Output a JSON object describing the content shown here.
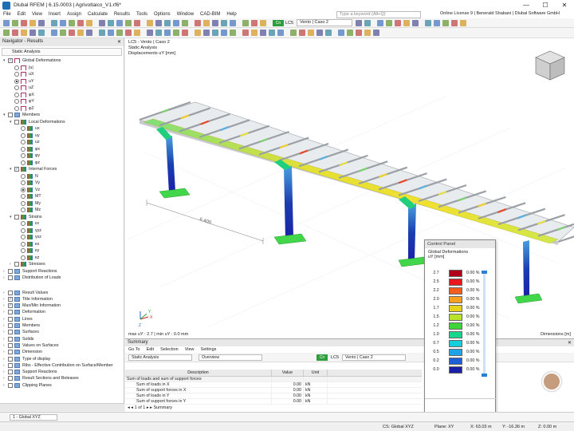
{
  "window": {
    "title": "Dlubal RFEM | 6.15.0003 | Agrivoltaico_V1.rf6*",
    "min": "—",
    "max": "☐",
    "close": "✕"
  },
  "menu": [
    "File",
    "Edit",
    "View",
    "Insert",
    "Assign",
    "Calculate",
    "Results",
    "Tools",
    "Options",
    "Window",
    "CAD-BIM",
    "Help"
  ],
  "search": {
    "placeholder": "Type a keyword (Alt+Q)"
  },
  "license": "Online License 9 | Benerald Shabani | Dlubal Software GmbH",
  "toolbar": {
    "load_tag": "Cn",
    "lc": "LC5",
    "lc_name": "Vento | Caso 2"
  },
  "navigator": {
    "title": "Navigator - Results",
    "combo": "Static Analysis",
    "items": [
      {
        "t": "Global Deformations",
        "lvl": 0,
        "ex": "▾",
        "c": "check",
        "on": true,
        "i": "ic"
      },
      {
        "t": "|u|",
        "lvl": 1,
        "c": "radio",
        "on": false,
        "i": "ic"
      },
      {
        "t": "uX",
        "lvl": 1,
        "c": "radio",
        "on": false,
        "i": "ic"
      },
      {
        "t": "uY",
        "lvl": 1,
        "c": "radio",
        "on": true,
        "i": "ic"
      },
      {
        "t": "uZ",
        "lvl": 1,
        "c": "radio",
        "on": false,
        "i": "ic"
      },
      {
        "t": "φX",
        "lvl": 1,
        "c": "radio",
        "on": false,
        "i": "ic"
      },
      {
        "t": "φY",
        "lvl": 1,
        "c": "radio",
        "on": false,
        "i": "ic"
      },
      {
        "t": "φZ",
        "lvl": 1,
        "c": "radio",
        "on": false,
        "i": "ic"
      },
      {
        "t": "Members",
        "lvl": 0,
        "ex": "▾",
        "c": "check",
        "on": false,
        "i": "ic3"
      },
      {
        "t": "Local Deformations",
        "lvl": 1,
        "ex": "▾",
        "c": "check",
        "on": false,
        "i": "ic2"
      },
      {
        "t": "ux",
        "lvl": 2,
        "c": "radio",
        "on": false,
        "i": "ic2"
      },
      {
        "t": "uy",
        "lvl": 2,
        "c": "radio",
        "on": false,
        "i": "ic2"
      },
      {
        "t": "uz",
        "lvl": 2,
        "c": "radio",
        "on": false,
        "i": "ic2"
      },
      {
        "t": "φx",
        "lvl": 2,
        "c": "radio",
        "on": false,
        "i": "ic2"
      },
      {
        "t": "φy",
        "lvl": 2,
        "c": "radio",
        "on": false,
        "i": "ic2"
      },
      {
        "t": "φz",
        "lvl": 2,
        "c": "radio",
        "on": false,
        "i": "ic2"
      },
      {
        "t": "Internal Forces",
        "lvl": 1,
        "ex": "▾",
        "c": "check",
        "on": true,
        "i": "ic2"
      },
      {
        "t": "N",
        "lvl": 2,
        "c": "radio",
        "on": false,
        "i": "ic2"
      },
      {
        "t": "Vy",
        "lvl": 2,
        "c": "radio",
        "on": false,
        "i": "ic2"
      },
      {
        "t": "Vz",
        "lvl": 2,
        "c": "radio",
        "on": true,
        "i": "ic2"
      },
      {
        "t": "MT",
        "lvl": 2,
        "c": "radio",
        "on": false,
        "i": "ic2"
      },
      {
        "t": "My",
        "lvl": 2,
        "c": "radio",
        "on": false,
        "i": "ic2"
      },
      {
        "t": "Mz",
        "lvl": 2,
        "c": "radio",
        "on": false,
        "i": "ic2"
      },
      {
        "t": "Strains",
        "lvl": 1,
        "ex": "▾",
        "c": "check",
        "on": false,
        "i": "ic2"
      },
      {
        "t": "εx",
        "lvl": 2,
        "c": "radio",
        "on": false,
        "i": "ic2"
      },
      {
        "t": "γyz",
        "lvl": 2,
        "c": "radio",
        "on": false,
        "i": "ic2"
      },
      {
        "t": "γxz",
        "lvl": 2,
        "c": "radio",
        "on": false,
        "i": "ic2"
      },
      {
        "t": "κx",
        "lvl": 2,
        "c": "radio",
        "on": false,
        "i": "ic2"
      },
      {
        "t": "κy",
        "lvl": 2,
        "c": "radio",
        "on": false,
        "i": "ic2"
      },
      {
        "t": "κz",
        "lvl": 2,
        "c": "radio",
        "on": false,
        "i": "ic2"
      },
      {
        "t": "Stresses",
        "lvl": 1,
        "ex": "›",
        "c": "check",
        "on": false,
        "i": "ic2"
      },
      {
        "t": "Support Reactions",
        "lvl": 0,
        "ex": "›",
        "c": "check",
        "on": false,
        "i": "ic3"
      },
      {
        "t": "Distribution of Loads",
        "lvl": 0,
        "ex": "›",
        "c": "check",
        "on": false,
        "i": "ic3"
      }
    ],
    "items2": [
      {
        "t": "Result Values",
        "ex": "›",
        "on": false
      },
      {
        "t": "Title Information",
        "ex": "›",
        "on": true
      },
      {
        "t": "Max/Min Information",
        "ex": "›",
        "on": true
      },
      {
        "t": "Deformation",
        "ex": "›",
        "on": false
      },
      {
        "t": "Lines",
        "ex": "›",
        "on": false
      },
      {
        "t": "Members",
        "ex": "›",
        "on": false
      },
      {
        "t": "Surfaces",
        "ex": "›",
        "on": false
      },
      {
        "t": "Solids",
        "ex": "›",
        "on": false
      },
      {
        "t": "Values on Surfaces",
        "ex": "›",
        "on": false
      },
      {
        "t": "Dimension",
        "ex": "›",
        "on": false
      },
      {
        "t": "Type of display",
        "ex": "›",
        "on": false
      },
      {
        "t": "Ribs - Effective Contribution on Surface/Member",
        "ex": "›",
        "on": false
      },
      {
        "t": "Support Reactions",
        "ex": "›",
        "on": false
      },
      {
        "t": "Result Sections and Releases",
        "ex": "›",
        "on": false
      },
      {
        "t": "Clipping Planes",
        "ex": "›",
        "on": false
      }
    ]
  },
  "viewport": {
    "line1": "LC5 - Vento | Caso 2",
    "line2": "Static Analysis",
    "line3": "Displacements uY [mm]",
    "maxmin": "max uY : 2.7 | min uY : 0.0 mm",
    "dims": "Dimensions [m]",
    "dim_label": "6.400",
    "axis_x": "X",
    "axis_y": "Y",
    "axis_z": "Z"
  },
  "summary": {
    "title": "Summary",
    "menu": [
      "Go To",
      "Edit",
      "Selection",
      "View",
      "Settings"
    ],
    "analysis": "Static Analysis",
    "overview": "Overview",
    "load_tag": "Cn",
    "lc": "LC5",
    "lc_name": "Vento | Caso 2",
    "cols": [
      "Description",
      "Value",
      "Unit"
    ],
    "rows": [
      {
        "d": "Sum of loads and sum of support forces",
        "v": "",
        "u": "",
        "g": true
      },
      {
        "d": "Sum of loads in X",
        "v": "0.00",
        "u": "kN",
        "g": false
      },
      {
        "d": "Sum of support forces in X",
        "v": "0.00",
        "u": "kN",
        "g": false
      },
      {
        "d": "Sum of loads in Y",
        "v": "0.00",
        "u": "kN",
        "g": false
      },
      {
        "d": "Sum of support forces in Y",
        "v": "0.00",
        "u": "kN",
        "g": false
      }
    ],
    "pager": "1 of 1",
    "tab": "Summary"
  },
  "control_panel": {
    "title": "Control Panel",
    "heading": "Global Deformations",
    "unit": "uY [mm]",
    "legend": [
      {
        "v": "2.7",
        "c": "#b0001a",
        "p": "0.00 %"
      },
      {
        "v": "2.5",
        "c": "#e8161e",
        "p": "0.00 %"
      },
      {
        "v": "2.2",
        "c": "#f25c1c",
        "p": "0.00 %"
      },
      {
        "v": "2.0",
        "c": "#f5a021",
        "p": "0.00 %"
      },
      {
        "v": "1.7",
        "c": "#e6d21c",
        "p": "0.00 %"
      },
      {
        "v": "1.5",
        "c": "#b9e22c",
        "p": "0.00 %"
      },
      {
        "v": "1.2",
        "c": "#3fd43a",
        "p": "0.00 %"
      },
      {
        "v": "1.0",
        "c": "#19d68e",
        "p": "0.00 %"
      },
      {
        "v": "0.7",
        "c": "#14cfd9",
        "p": "0.00 %"
      },
      {
        "v": "0.5",
        "c": "#1ea2e8",
        "p": "0.00 %"
      },
      {
        "v": "0.2",
        "c": "#1d5fd6",
        "p": "0.00 %"
      },
      {
        "v": "0.0",
        "c": "#1a1fa8",
        "p": "0.00 %"
      }
    ]
  },
  "statusbar": {
    "view": "1 - Global XYZ",
    "cs": "CS: Global XYZ",
    "plane": "Plane: XY",
    "x": "X: 63.03 m",
    "y": "Y: -16.36 m",
    "z": "Z: 0.00 m"
  }
}
